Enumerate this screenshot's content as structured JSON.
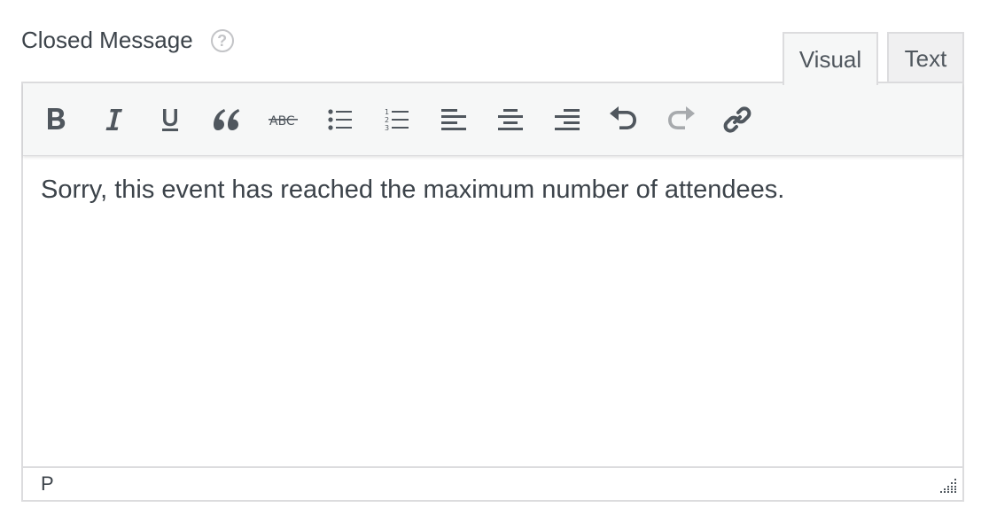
{
  "field": {
    "label": "Closed Message",
    "help_icon": "question-circle-icon",
    "help_glyph": "?"
  },
  "tabs": [
    {
      "label": "Visual",
      "active": true
    },
    {
      "label": "Text",
      "active": false
    }
  ],
  "toolbar": {
    "buttons": [
      {
        "name": "bold",
        "icon": "bold-icon"
      },
      {
        "name": "italic",
        "icon": "italic-icon"
      },
      {
        "name": "underline",
        "icon": "underline-icon"
      },
      {
        "name": "blockquote",
        "icon": "quote-icon"
      },
      {
        "name": "strikethrough",
        "icon": "strikethrough-icon"
      },
      {
        "name": "bulleted-list",
        "icon": "bullet-list-icon"
      },
      {
        "name": "numbered-list",
        "icon": "numbered-list-icon"
      },
      {
        "name": "align-left",
        "icon": "align-left-icon"
      },
      {
        "name": "align-center",
        "icon": "align-center-icon"
      },
      {
        "name": "align-right",
        "icon": "align-right-icon"
      },
      {
        "name": "undo",
        "icon": "undo-icon",
        "disabled": false
      },
      {
        "name": "redo",
        "icon": "redo-icon",
        "disabled": true
      },
      {
        "name": "link",
        "icon": "link-icon"
      }
    ]
  },
  "editor": {
    "content": "Sorry, this event has reached the maximum number of attendees."
  },
  "statusbar": {
    "path": "P"
  },
  "colors": {
    "icon": "#50575e",
    "icon_disabled": "#a7aaad",
    "border": "#dcdcde",
    "toolbar_bg": "#f6f7f7"
  }
}
